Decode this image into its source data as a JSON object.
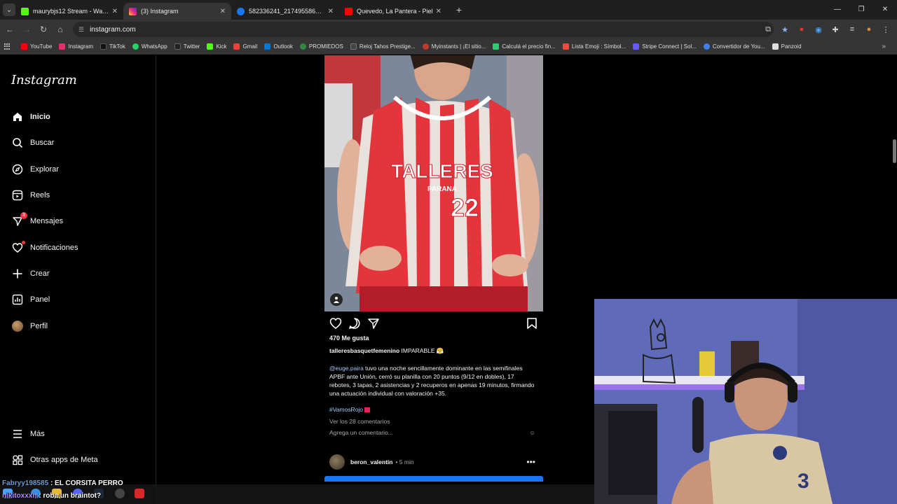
{
  "browser": {
    "tabs": [
      {
        "title": "maurybjs12 Stream - Watch Liv",
        "color": "#53fc18",
        "active": false
      },
      {
        "title": "(3) Instagram",
        "color": "#e1306c",
        "active": true
      },
      {
        "title": "582336241_21749558630574",
        "color": "#1877f2",
        "active": false
      },
      {
        "title": "Quevedo, La Pantera - Piel",
        "color": "#ff0000",
        "active": false
      }
    ],
    "url": "instagram.com",
    "bookmarks": [
      {
        "label": "YouTube",
        "color": "#ff0000"
      },
      {
        "label": "Instagram",
        "color": "#e1306c"
      },
      {
        "label": "TikTok",
        "color": "#111111"
      },
      {
        "label": "WhatsApp",
        "color": "#25d366"
      },
      {
        "label": "Twitter",
        "color": "#222222"
      },
      {
        "label": "Kick",
        "color": "#53fc18"
      },
      {
        "label": "Gmail",
        "color": "#ea4335"
      },
      {
        "label": "Outlook",
        "color": "#0078d4"
      },
      {
        "label": "PROMIEDOS",
        "color": "#2e8b3e"
      },
      {
        "label": "Reloj Tahos Prestige...",
        "color": "#444444"
      },
      {
        "label": "Myinstants | ¡El sitio...",
        "color": "#c0392b"
      },
      {
        "label": "Calculá el precio fin...",
        "color": "#2ecc71"
      },
      {
        "label": "Lista Emoji : Símbol...",
        "color": "#e74c3c"
      },
      {
        "label": "Stripe Connect | Sol...",
        "color": "#635bff"
      },
      {
        "label": "Convertidor de You...",
        "color": "#3b82f6"
      },
      {
        "label": "Panzoid",
        "color": "#dddddd"
      }
    ]
  },
  "sidebar": {
    "logo": "Instagram",
    "items": [
      {
        "label": "Inicio",
        "icon": "home-icon"
      },
      {
        "label": "Buscar",
        "icon": "search-icon"
      },
      {
        "label": "Explorar",
        "icon": "compass-icon"
      },
      {
        "label": "Reels",
        "icon": "reels-icon"
      },
      {
        "label": "Mensajes",
        "icon": "messenger-icon",
        "badge": "3"
      },
      {
        "label": "Notificaciones",
        "icon": "heart-icon"
      },
      {
        "label": "Crear",
        "icon": "plus-icon"
      },
      {
        "label": "Panel",
        "icon": "chart-icon"
      },
      {
        "label": "Perfil",
        "icon": "avatar"
      }
    ],
    "more": "Más",
    "meta": "Otras apps de Meta"
  },
  "post": {
    "jersey_text": "TALLERES",
    "jersey_sub": "PARANÁ",
    "jersey_number": "22",
    "likes": "470 Me gusta",
    "author": "talleresbasquetfemenino",
    "caption": "IMPARABLE 😤",
    "mention": "@euge.paira",
    "description": " tuvo una noche sencillamente dominante en las semifinales APBF ante Unión, cerró su planilla con 20 puntos (9/12 en dobles), 17 rebotes, 3 tapas, 2 asistencias y 2 recuperos en apenas 19 minutos, firmando una actuación individual con valoración +35.",
    "hashtag": "#VamosRojo",
    "comments_link": "Ver los 28 comentarios",
    "comment_placeholder": "Agrega un comentario...",
    "emoji_icon": "☺"
  },
  "next_post": {
    "user": "beron_valentin",
    "time": "• 5 min",
    "more": "•••"
  },
  "chat": [
    {
      "user": "Fabryy198585",
      "message": " : EL CORSITA PERRO"
    },
    {
      "user": "nikitoxxxn",
      "message": " : roba un braintot?"
    }
  ]
}
